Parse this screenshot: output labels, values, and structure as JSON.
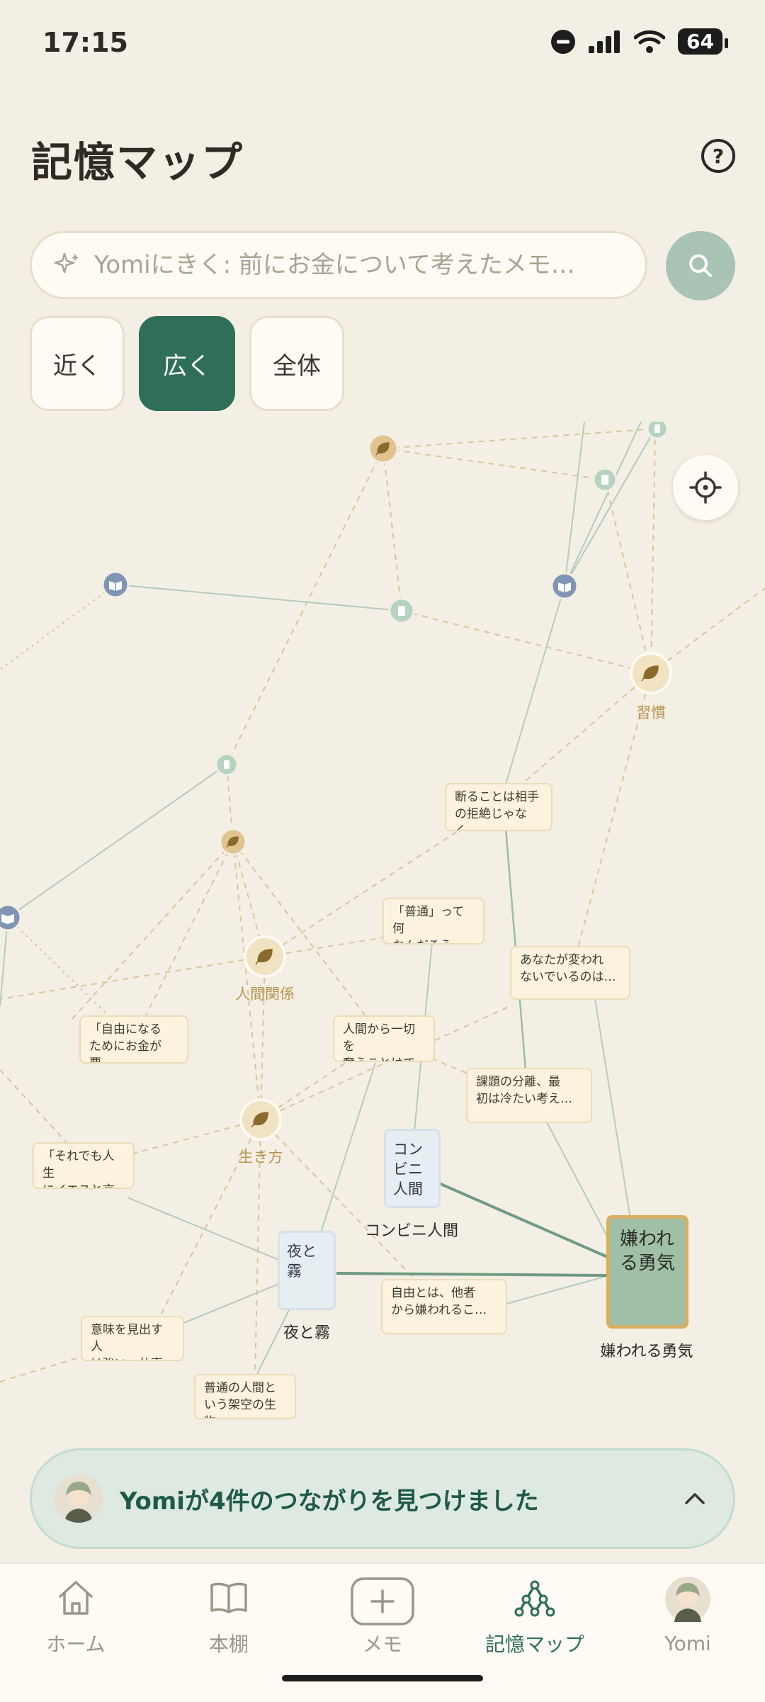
{
  "status_bar": {
    "time": "17:15",
    "battery": "64"
  },
  "header": {
    "title": "記憶マップ",
    "help_icon": "question-circle-icon"
  },
  "search": {
    "placeholder": "Yomiにきく: 前にお金について考えたメモ…",
    "value": ""
  },
  "filters": [
    {
      "label": "近く",
      "active": false
    },
    {
      "label": "広く",
      "active": true
    },
    {
      "label": "全体",
      "active": false
    }
  ],
  "map": {
    "tags": [
      {
        "label": "習慣"
      },
      {
        "label": "人間関係"
      },
      {
        "label": "生き方"
      }
    ],
    "memos": [
      {
        "text": "断ることは相手\nの拒絶じゃなく…"
      },
      {
        "text": "「普通」って何\nなんだろう。古…"
      },
      {
        "text": "あなたが変われ\nないでいるのは…"
      },
      {
        "text": "「自由になる\nためにお金が要…"
      },
      {
        "text": "人間から一切を\n奪うことはでき…"
      },
      {
        "text": "課題の分離、最\n初は冷たい考え…"
      },
      {
        "text": "「それでも人生\nにイエスと言う…"
      },
      {
        "text": "自由とは、他者\nから嫌われるこ…"
      },
      {
        "text": "意味を見出す人\nは強い。仕事の…"
      },
      {
        "text": "普通の人間と\nいう架空の生物…"
      }
    ],
    "books": [
      {
        "cover": "コンビニ人間",
        "label": "コンビニ人間"
      },
      {
        "cover": "夜と霧",
        "label": "夜と霧"
      },
      {
        "cover": "嫌われる勇気",
        "label": "嫌われる勇気",
        "featured": true
      }
    ]
  },
  "banner": {
    "text": "Yomiが4件のつながりを見つけました"
  },
  "nav": [
    {
      "label": "ホーム",
      "icon": "home-icon",
      "active": false
    },
    {
      "label": "本棚",
      "icon": "book-icon",
      "active": false
    },
    {
      "label": "メモ",
      "icon": "plus-icon",
      "active": false
    },
    {
      "label": "記憶マップ",
      "icon": "network-icon",
      "active": true
    },
    {
      "label": "Yomi",
      "icon": "avatar-icon",
      "active": false
    }
  ],
  "colors": {
    "accent": "#2f6f5a",
    "tag": "#b89450",
    "background": "#f4efe4"
  }
}
